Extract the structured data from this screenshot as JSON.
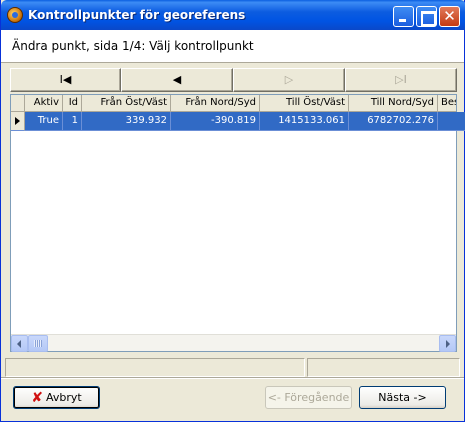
{
  "window": {
    "title": "Kontrollpunkter för georeferens"
  },
  "header": {
    "text": "Ändra punkt, sida 1/4: Välj kontrollpunkt"
  },
  "navigation": {
    "first_symbol": "I◀",
    "prev_symbol": "◀",
    "next_symbol": "▷",
    "last_symbol": "▷I"
  },
  "grid": {
    "columns": [
      "Aktiv",
      "Id",
      "Från Öst/Väst",
      "Från Nord/Syd",
      "Till Öst/Väst",
      "Till Nord/Syd",
      "Bes"
    ],
    "rows": [
      {
        "aktiv": "True",
        "id": "1",
        "fran_ost_vast": "339.932",
        "fran_nord_syd": "-390.819",
        "till_ost_vast": "1415133.061",
        "till_nord_syd": "6782702.276",
        "bes": ""
      }
    ],
    "selected_row": 0
  },
  "buttons": {
    "cancel": "Avbryt",
    "previous": "<- Föregående",
    "next": "Nästa ->"
  },
  "colors": {
    "titlebar": "#0054e3",
    "selection": "#316ac5",
    "window_bg": "#ece9d8",
    "cancel_icon": "#d01010"
  }
}
